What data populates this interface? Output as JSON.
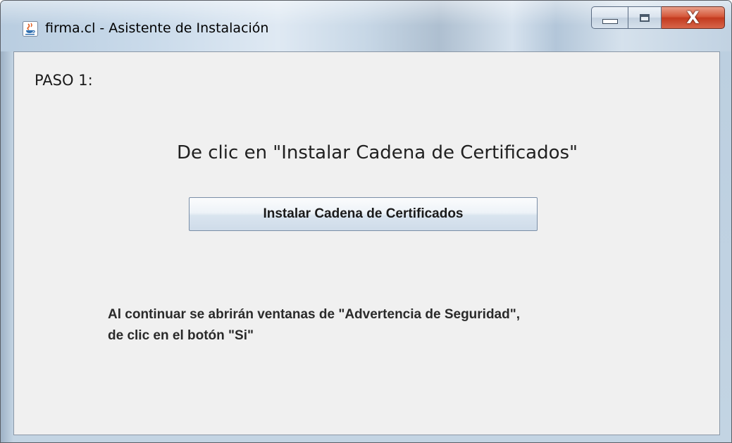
{
  "window": {
    "title": "firma.cl - Asistente de Instalación",
    "controls": {
      "minimize": "minimize",
      "maximize": "maximize",
      "close": "X"
    }
  },
  "content": {
    "step_label": "PASO 1:",
    "instruction": "De clic en \"Instalar Cadena de Certificados\"",
    "install_button_label": "Instalar Cadena de Certificados",
    "warning_line1": "Al continuar se abrirán ventanas de \"Advertencia de Seguridad\",",
    "warning_line2": "de clic en el botón \"Si\""
  },
  "icons": {
    "app": "java-coffee-icon",
    "minimize": "minimize-icon",
    "maximize": "maximize-icon",
    "close": "close-icon"
  }
}
